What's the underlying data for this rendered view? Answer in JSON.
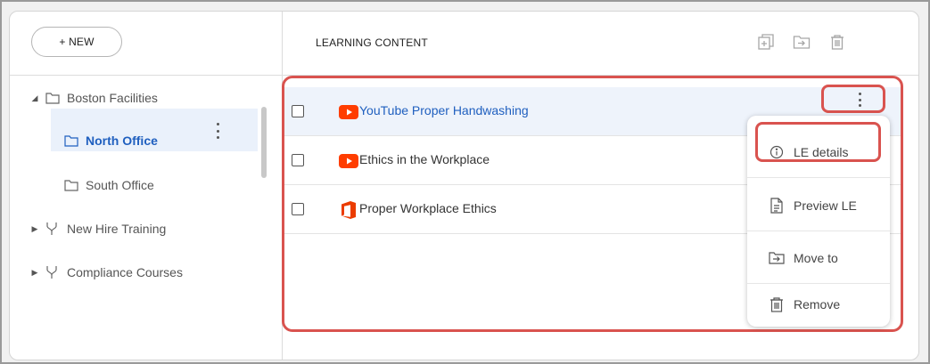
{
  "toolbar": {
    "new_label": "+ NEW"
  },
  "content_header": {
    "title": "LEARNING CONTENT"
  },
  "header_icons": [
    "copy-add-icon",
    "move-folder-icon",
    "trash-icon"
  ],
  "tree": {
    "items": [
      {
        "label": "Boston Facilities",
        "type": "folder",
        "expanded": true
      },
      {
        "label": "North Office",
        "type": "folder",
        "selected": true
      },
      {
        "label": "South Office",
        "type": "folder"
      },
      {
        "label": "New Hire Training",
        "type": "fork",
        "expanded": false
      },
      {
        "label": "Compliance Courses",
        "type": "fork",
        "expanded": false
      }
    ]
  },
  "content": {
    "rows": [
      {
        "label": "YouTube Proper Handwashing",
        "icon": "youtube-icon",
        "selected": true
      },
      {
        "label": "Ethics in the Workplace",
        "icon": "youtube-icon"
      },
      {
        "label": "Proper Workplace Ethics",
        "icon": "office-icon"
      }
    ]
  },
  "context_menu": {
    "items": [
      {
        "label": "LE details",
        "icon": "info-icon"
      },
      {
        "label": "Preview LE",
        "icon": "document-icon"
      },
      {
        "label": "Move to",
        "icon": "move-folder-icon"
      },
      {
        "label": "Remove",
        "icon": "trash-icon"
      }
    ]
  },
  "colors": {
    "accent": "#1f5fbf",
    "highlight_outline": "#d9534f",
    "youtube": "#ff3d00",
    "office": "#eb3c00"
  }
}
